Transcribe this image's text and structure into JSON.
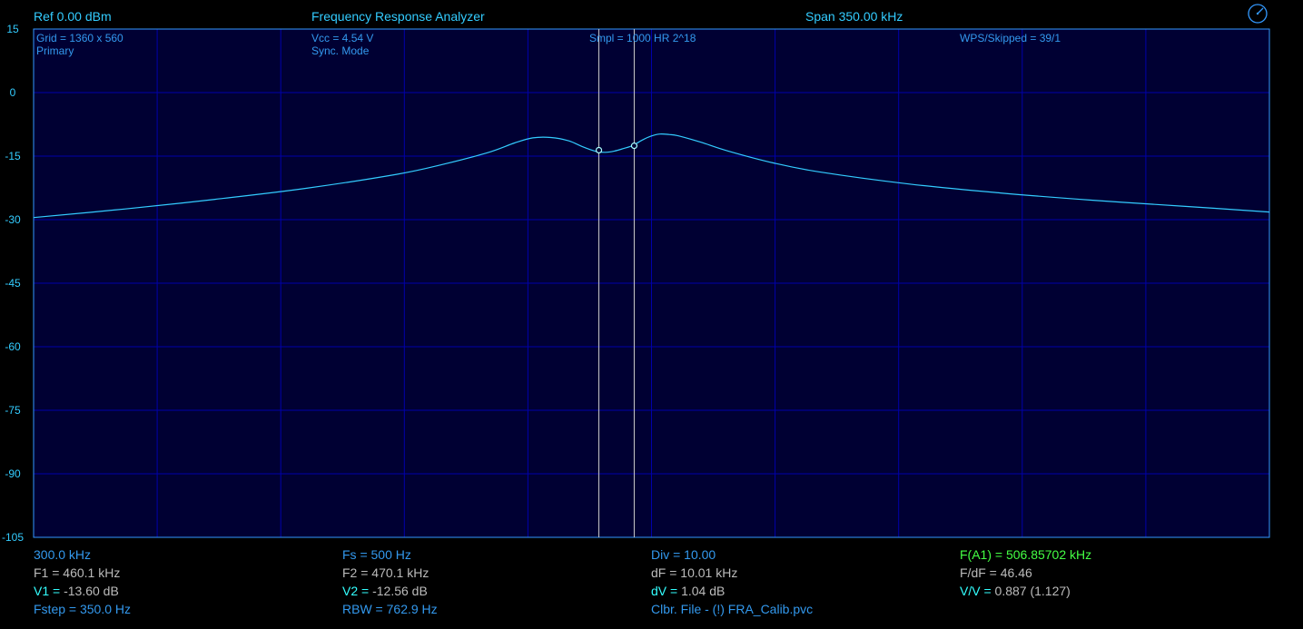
{
  "header": {
    "ref": "Ref  0.00 dBm",
    "title": "Frequency Response Analyzer",
    "span": "Span 350.00 kHz",
    "settings_icon": "gauge-dial-icon"
  },
  "grid_info": {
    "grid": "Grid = 1360 x 560",
    "channel": "Primary",
    "vcc": "Vcc = 4.54 V",
    "mode": "Sync. Mode",
    "smpl": "Smpl = 1000 HR 2^18",
    "wps": "WPS/Skipped  = 39/1"
  },
  "y_axis": {
    "ticks": [
      "15",
      "0",
      "-15",
      "-30",
      "-45",
      "-60",
      "-75",
      "-90",
      "-105"
    ]
  },
  "colors": {
    "background": "#000000",
    "plot_background": "#000033",
    "grid": "#0000aa",
    "frame": "#3399ff",
    "trace": "#33ccff",
    "marker_line": "#cccccc"
  },
  "chart_data": {
    "type": "line",
    "x_range_khz": [
      300.0,
      650.0
    ],
    "ylim": [
      -105,
      15
    ],
    "grid": true,
    "markers": {
      "f1_khz": 460.1,
      "v1_db": -13.6,
      "f2_khz": 470.1,
      "v2_db": -12.56
    },
    "series": [
      {
        "x": [
          300.0,
          325.7,
          351.4,
          377.1,
          402.8,
          415.7,
          428.5,
          436.2,
          441.4,
          446.5,
          451.6,
          455.5,
          459.4,
          462.0,
          464.5,
          467.1,
          469.7,
          472.2,
          474.8,
          477.4,
          480.0,
          482.5,
          488.9,
          496.7,
          509.5,
          522.4,
          548.1,
          573.8,
          599.5,
          625.2,
          650.0
        ],
        "y": [
          -29.5,
          -27.5,
          -25.2,
          -22.6,
          -19.3,
          -17.0,
          -14.2,
          -11.9,
          -10.7,
          -10.6,
          -11.4,
          -12.8,
          -13.9,
          -14.1,
          -13.8,
          -13.2,
          -12.5,
          -11.3,
          -10.3,
          -9.8,
          -9.9,
          -10.2,
          -11.7,
          -13.8,
          -16.6,
          -18.7,
          -21.6,
          -23.7,
          -25.4,
          -26.8,
          -28.2
        ]
      }
    ]
  },
  "footer": {
    "col1": {
      "start_freq": "300.0 kHz",
      "f1": "F1 = 460.1 kHz",
      "v1_label": "V1 = ",
      "v1_value": "-13.60 dB",
      "fstep": "Fstep = 350.0 Hz"
    },
    "col2": {
      "fs": "Fs = 500 Hz",
      "f2": "F2 = 470.1 kHz",
      "v2_label": "V2 = ",
      "v2_value": "-12.56 dB",
      "rbw": "RBW = 762.9 Hz"
    },
    "col3": {
      "div": "Div = 10.00",
      "df": "dF = 10.01 kHz",
      "dv_label": "dV = ",
      "dv_value": "1.04 dB",
      "clbr": "Clbr. File - (!) FRA_Calib.pvc"
    },
    "col4": {
      "fa1": "F(A1) = 506.85702 kHz",
      "fdf": "F/dF = 46.46",
      "vv_label": "V/V = ",
      "vv_value": "0.887 (1.127)"
    }
  }
}
